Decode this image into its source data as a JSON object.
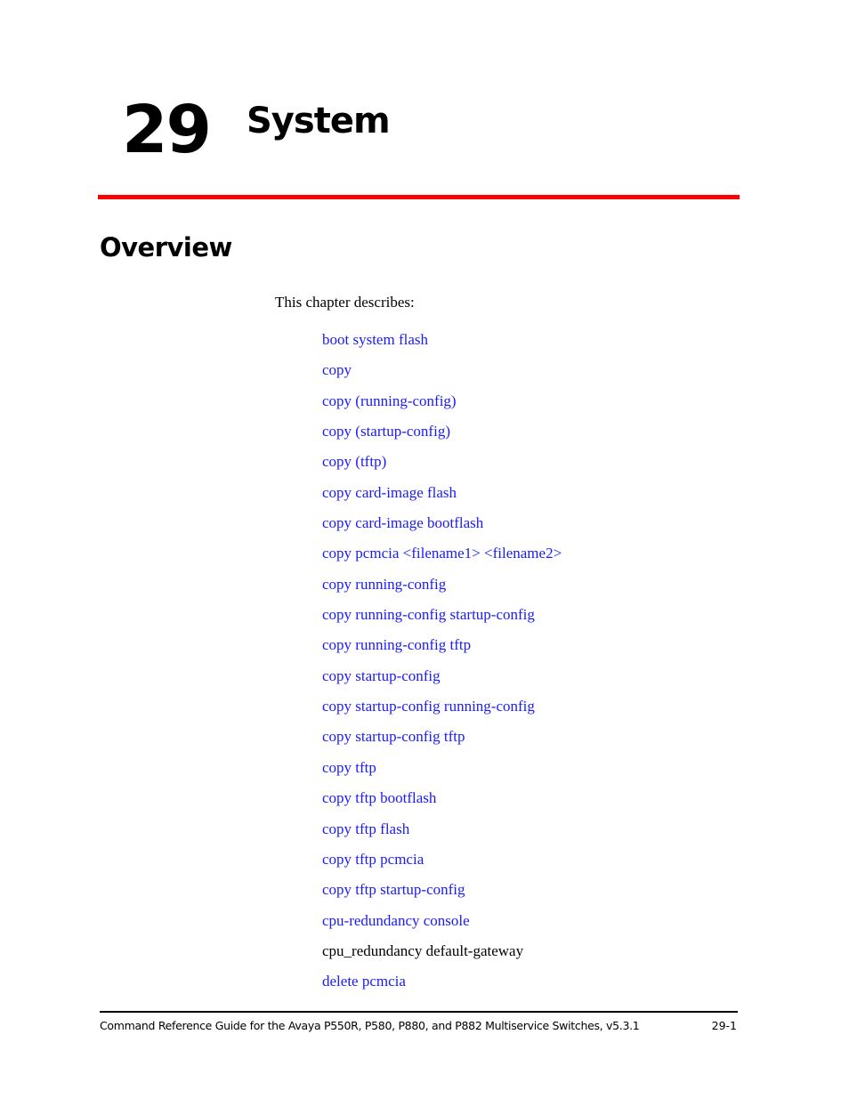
{
  "chapter": {
    "number": "29",
    "title": "System"
  },
  "colors": {
    "rule": "#ff0000",
    "link": "#1a1aff",
    "text": "#000000"
  },
  "section": {
    "heading": "Overview",
    "intro": "This chapter describes:"
  },
  "toc": [
    {
      "label": "boot system flash",
      "link": true
    },
    {
      "label": "copy",
      "link": true
    },
    {
      "label": "copy (running-config)",
      "link": true
    },
    {
      "label": "copy (startup-config)",
      "link": true
    },
    {
      "label": "copy (tftp)",
      "link": true
    },
    {
      "label": "copy card-image flash",
      "link": true
    },
    {
      "label": "copy card-image bootflash",
      "link": true
    },
    {
      "label": "copy pcmcia <filename1> <filename2>",
      "link": true
    },
    {
      "label": "copy running-config",
      "link": true
    },
    {
      "label": "copy running-config startup-config",
      "link": true
    },
    {
      "label": "copy running-config tftp",
      "link": true
    },
    {
      "label": "copy startup-config",
      "link": true
    },
    {
      "label": "copy startup-config running-config",
      "link": true
    },
    {
      "label": "copy startup-config tftp",
      "link": true
    },
    {
      "label": "copy tftp",
      "link": true
    },
    {
      "label": "copy tftp bootflash",
      "link": true
    },
    {
      "label": "copy tftp flash",
      "link": true
    },
    {
      "label": "copy tftp pcmcia",
      "link": true
    },
    {
      "label": "copy tftp startup-config",
      "link": true
    },
    {
      "label": "cpu-redundancy console",
      "link": true
    },
    {
      "label": "cpu_redundancy default-gateway",
      "link": false
    },
    {
      "label": "delete pcmcia",
      "link": true
    }
  ],
  "footer": {
    "title": "Command Reference Guide for the Avaya P550R, P580, P880, and P882 Multiservice Switches, v5.3.1",
    "page": "29-1"
  }
}
